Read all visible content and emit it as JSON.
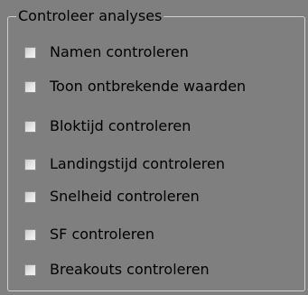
{
  "group": {
    "title": "Controleer analyses"
  },
  "options": [
    {
      "label": "Namen controleren",
      "checked": false
    },
    {
      "label": "Toon ontbrekende waarden",
      "checked": false
    },
    {
      "label": "Bloktijd controleren",
      "checked": false
    },
    {
      "label": "Landingstijd controleren",
      "checked": false
    },
    {
      "label": "Snelheid controleren",
      "checked": false
    },
    {
      "label": "SF controleren",
      "checked": false
    },
    {
      "label": "Breakouts controleren",
      "checked": false
    }
  ]
}
